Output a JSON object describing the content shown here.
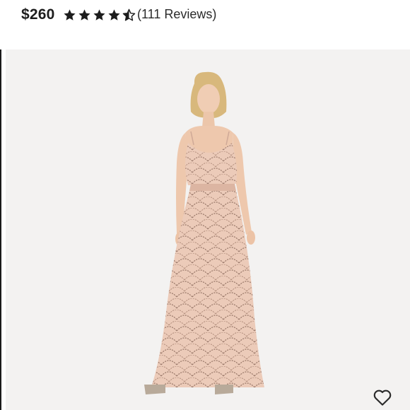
{
  "product": {
    "price": "$260",
    "rating": 4.5,
    "rating_max": 5,
    "reviews_label": "(111 Reviews)"
  },
  "icons": {
    "star": "star-icon",
    "half_star": "half-star-icon",
    "like": "heart-icon"
  },
  "colors": {
    "text": "#1d1d1d",
    "photo_background": "#f3f2f1",
    "dress": "#eccbb9",
    "beading": "#8c6a5c"
  }
}
